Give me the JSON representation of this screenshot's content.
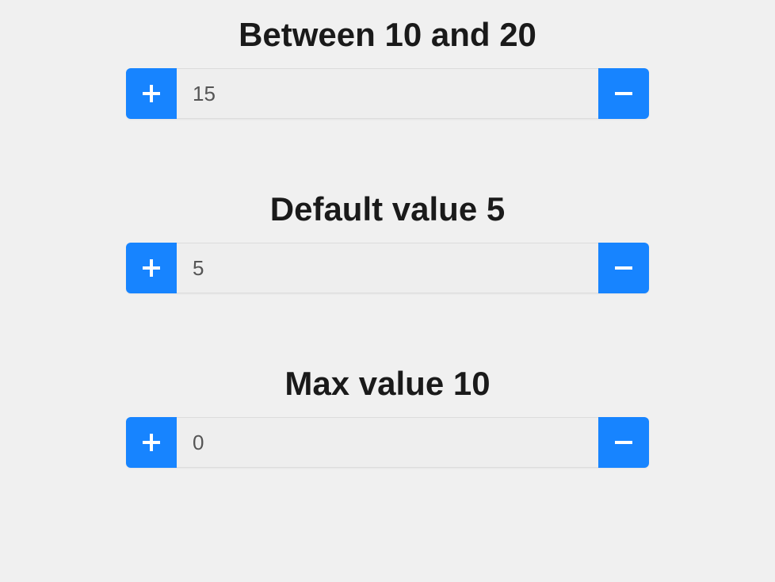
{
  "steppers": [
    {
      "title": "Between 10 and 20",
      "value": "15"
    },
    {
      "title": "Default value 5",
      "value": "5"
    },
    {
      "title": "Max value 10",
      "value": "0"
    }
  ],
  "icons": {
    "plus": "+",
    "minus": "−"
  }
}
